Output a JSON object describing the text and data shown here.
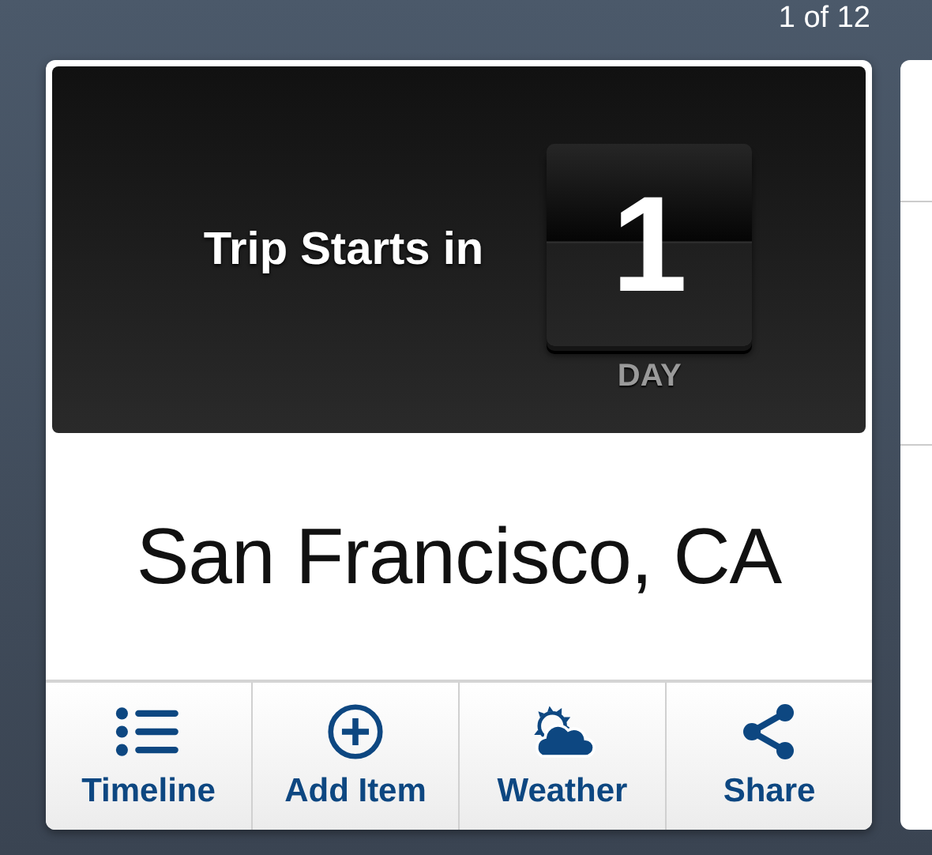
{
  "pager": "1 of 12",
  "countdown": {
    "label": "Trip Starts in",
    "value": "1",
    "unit": "DAY"
  },
  "destination": "San Francisco, CA",
  "actions": [
    {
      "label": "Timeline",
      "kind": "list"
    },
    {
      "label": "Add Item",
      "kind": "add"
    },
    {
      "label": "Weather",
      "kind": "weather"
    },
    {
      "label": "Share",
      "kind": "share"
    }
  ]
}
